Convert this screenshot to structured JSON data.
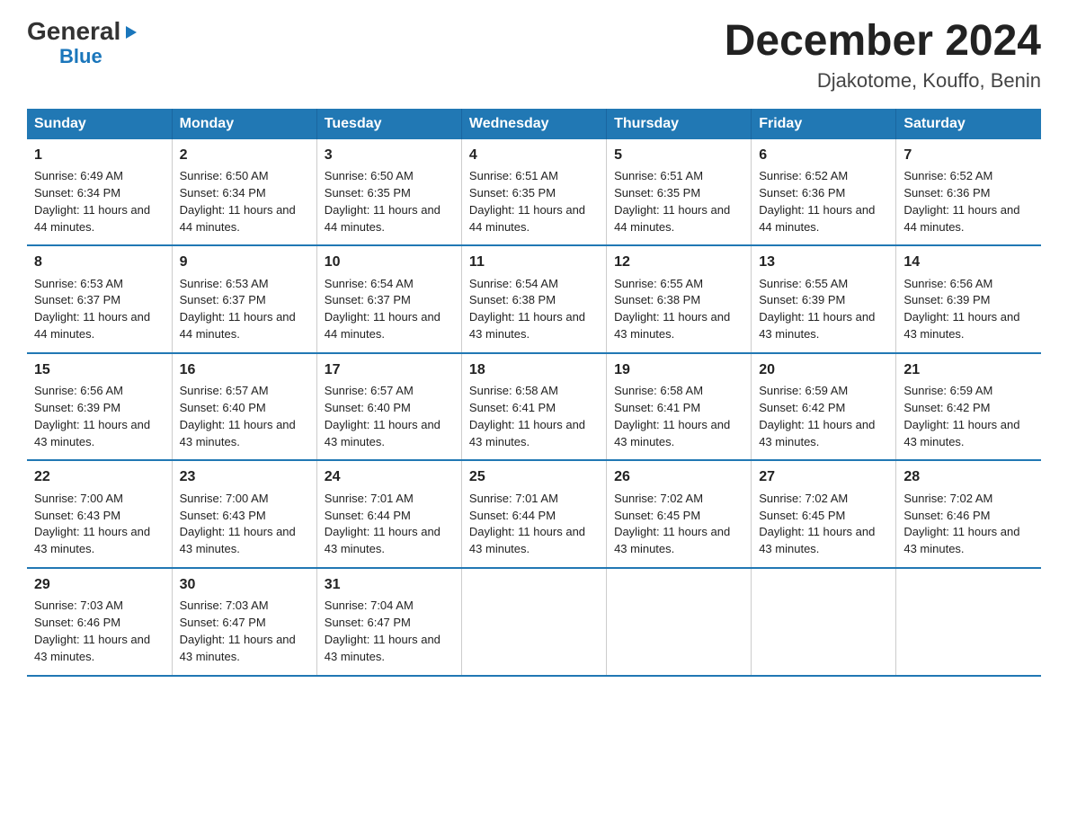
{
  "logo": {
    "general": "General",
    "arrow": "▶",
    "blue": "Blue"
  },
  "title": {
    "month": "December 2024",
    "location": "Djakotome, Kouffo, Benin"
  },
  "weekdays": [
    "Sunday",
    "Monday",
    "Tuesday",
    "Wednesday",
    "Thursday",
    "Friday",
    "Saturday"
  ],
  "weeks": [
    [
      {
        "day": "1",
        "sunrise": "Sunrise: 6:49 AM",
        "sunset": "Sunset: 6:34 PM",
        "daylight": "Daylight: 11 hours and 44 minutes."
      },
      {
        "day": "2",
        "sunrise": "Sunrise: 6:50 AM",
        "sunset": "Sunset: 6:34 PM",
        "daylight": "Daylight: 11 hours and 44 minutes."
      },
      {
        "day": "3",
        "sunrise": "Sunrise: 6:50 AM",
        "sunset": "Sunset: 6:35 PM",
        "daylight": "Daylight: 11 hours and 44 minutes."
      },
      {
        "day": "4",
        "sunrise": "Sunrise: 6:51 AM",
        "sunset": "Sunset: 6:35 PM",
        "daylight": "Daylight: 11 hours and 44 minutes."
      },
      {
        "day": "5",
        "sunrise": "Sunrise: 6:51 AM",
        "sunset": "Sunset: 6:35 PM",
        "daylight": "Daylight: 11 hours and 44 minutes."
      },
      {
        "day": "6",
        "sunrise": "Sunrise: 6:52 AM",
        "sunset": "Sunset: 6:36 PM",
        "daylight": "Daylight: 11 hours and 44 minutes."
      },
      {
        "day": "7",
        "sunrise": "Sunrise: 6:52 AM",
        "sunset": "Sunset: 6:36 PM",
        "daylight": "Daylight: 11 hours and 44 minutes."
      }
    ],
    [
      {
        "day": "8",
        "sunrise": "Sunrise: 6:53 AM",
        "sunset": "Sunset: 6:37 PM",
        "daylight": "Daylight: 11 hours and 44 minutes."
      },
      {
        "day": "9",
        "sunrise": "Sunrise: 6:53 AM",
        "sunset": "Sunset: 6:37 PM",
        "daylight": "Daylight: 11 hours and 44 minutes."
      },
      {
        "day": "10",
        "sunrise": "Sunrise: 6:54 AM",
        "sunset": "Sunset: 6:37 PM",
        "daylight": "Daylight: 11 hours and 44 minutes."
      },
      {
        "day": "11",
        "sunrise": "Sunrise: 6:54 AM",
        "sunset": "Sunset: 6:38 PM",
        "daylight": "Daylight: 11 hours and 43 minutes."
      },
      {
        "day": "12",
        "sunrise": "Sunrise: 6:55 AM",
        "sunset": "Sunset: 6:38 PM",
        "daylight": "Daylight: 11 hours and 43 minutes."
      },
      {
        "day": "13",
        "sunrise": "Sunrise: 6:55 AM",
        "sunset": "Sunset: 6:39 PM",
        "daylight": "Daylight: 11 hours and 43 minutes."
      },
      {
        "day": "14",
        "sunrise": "Sunrise: 6:56 AM",
        "sunset": "Sunset: 6:39 PM",
        "daylight": "Daylight: 11 hours and 43 minutes."
      }
    ],
    [
      {
        "day": "15",
        "sunrise": "Sunrise: 6:56 AM",
        "sunset": "Sunset: 6:39 PM",
        "daylight": "Daylight: 11 hours and 43 minutes."
      },
      {
        "day": "16",
        "sunrise": "Sunrise: 6:57 AM",
        "sunset": "Sunset: 6:40 PM",
        "daylight": "Daylight: 11 hours and 43 minutes."
      },
      {
        "day": "17",
        "sunrise": "Sunrise: 6:57 AM",
        "sunset": "Sunset: 6:40 PM",
        "daylight": "Daylight: 11 hours and 43 minutes."
      },
      {
        "day": "18",
        "sunrise": "Sunrise: 6:58 AM",
        "sunset": "Sunset: 6:41 PM",
        "daylight": "Daylight: 11 hours and 43 minutes."
      },
      {
        "day": "19",
        "sunrise": "Sunrise: 6:58 AM",
        "sunset": "Sunset: 6:41 PM",
        "daylight": "Daylight: 11 hours and 43 minutes."
      },
      {
        "day": "20",
        "sunrise": "Sunrise: 6:59 AM",
        "sunset": "Sunset: 6:42 PM",
        "daylight": "Daylight: 11 hours and 43 minutes."
      },
      {
        "day": "21",
        "sunrise": "Sunrise: 6:59 AM",
        "sunset": "Sunset: 6:42 PM",
        "daylight": "Daylight: 11 hours and 43 minutes."
      }
    ],
    [
      {
        "day": "22",
        "sunrise": "Sunrise: 7:00 AM",
        "sunset": "Sunset: 6:43 PM",
        "daylight": "Daylight: 11 hours and 43 minutes."
      },
      {
        "day": "23",
        "sunrise": "Sunrise: 7:00 AM",
        "sunset": "Sunset: 6:43 PM",
        "daylight": "Daylight: 11 hours and 43 minutes."
      },
      {
        "day": "24",
        "sunrise": "Sunrise: 7:01 AM",
        "sunset": "Sunset: 6:44 PM",
        "daylight": "Daylight: 11 hours and 43 minutes."
      },
      {
        "day": "25",
        "sunrise": "Sunrise: 7:01 AM",
        "sunset": "Sunset: 6:44 PM",
        "daylight": "Daylight: 11 hours and 43 minutes."
      },
      {
        "day": "26",
        "sunrise": "Sunrise: 7:02 AM",
        "sunset": "Sunset: 6:45 PM",
        "daylight": "Daylight: 11 hours and 43 minutes."
      },
      {
        "day": "27",
        "sunrise": "Sunrise: 7:02 AM",
        "sunset": "Sunset: 6:45 PM",
        "daylight": "Daylight: 11 hours and 43 minutes."
      },
      {
        "day": "28",
        "sunrise": "Sunrise: 7:02 AM",
        "sunset": "Sunset: 6:46 PM",
        "daylight": "Daylight: 11 hours and 43 minutes."
      }
    ],
    [
      {
        "day": "29",
        "sunrise": "Sunrise: 7:03 AM",
        "sunset": "Sunset: 6:46 PM",
        "daylight": "Daylight: 11 hours and 43 minutes."
      },
      {
        "day": "30",
        "sunrise": "Sunrise: 7:03 AM",
        "sunset": "Sunset: 6:47 PM",
        "daylight": "Daylight: 11 hours and 43 minutes."
      },
      {
        "day": "31",
        "sunrise": "Sunrise: 7:04 AM",
        "sunset": "Sunset: 6:47 PM",
        "daylight": "Daylight: 11 hours and 43 minutes."
      },
      null,
      null,
      null,
      null
    ]
  ]
}
